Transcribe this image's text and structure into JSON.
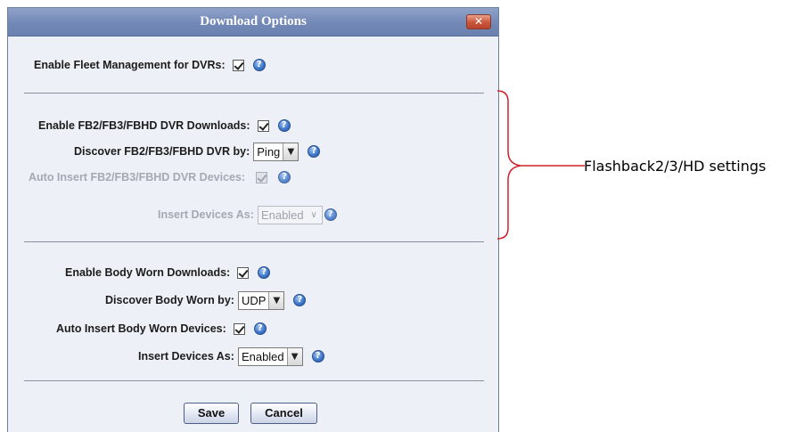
{
  "dialog": {
    "title": "Download Options",
    "close_label": "✕"
  },
  "fleet": {
    "enable_label": "Enable Fleet Management for DVRs:",
    "enable_checked": true,
    "help_glyph": "?"
  },
  "flashback": {
    "enable_label": "Enable FB2/FB3/FBHD DVR Downloads:",
    "enable_checked": true,
    "discover_label": "Discover FB2/FB3/FBHD DVR by:",
    "discover_value": "Ping",
    "auto_insert_label": "Auto Insert FB2/FB3/FBHD DVR Devices:",
    "auto_insert_checked": true,
    "auto_insert_disabled": true,
    "insert_as_label": "Insert Devices As:",
    "insert_as_value": "Enabled",
    "insert_as_disabled": true
  },
  "body_worn": {
    "enable_label": "Enable Body Worn Downloads:",
    "enable_checked": true,
    "discover_label": "Discover Body Worn by:",
    "discover_value": "UDP",
    "auto_insert_label": "Auto Insert Body Worn Devices:",
    "auto_insert_checked": true,
    "insert_as_label": "Insert Devices As:",
    "insert_as_value": "Enabled"
  },
  "buttons": {
    "save": "Save",
    "cancel": "Cancel"
  },
  "annotation": {
    "label": "Flashback2/3/HD settings",
    "brace_color": "#d0202a"
  },
  "icons": {
    "help": "help-icon",
    "dropdown": "chevron-down-icon",
    "close": "close-icon"
  },
  "colors": {
    "titlebar": "#7288b6",
    "dialog_bg": "#eef0f7",
    "disabled_text": "#a4a8b2"
  }
}
